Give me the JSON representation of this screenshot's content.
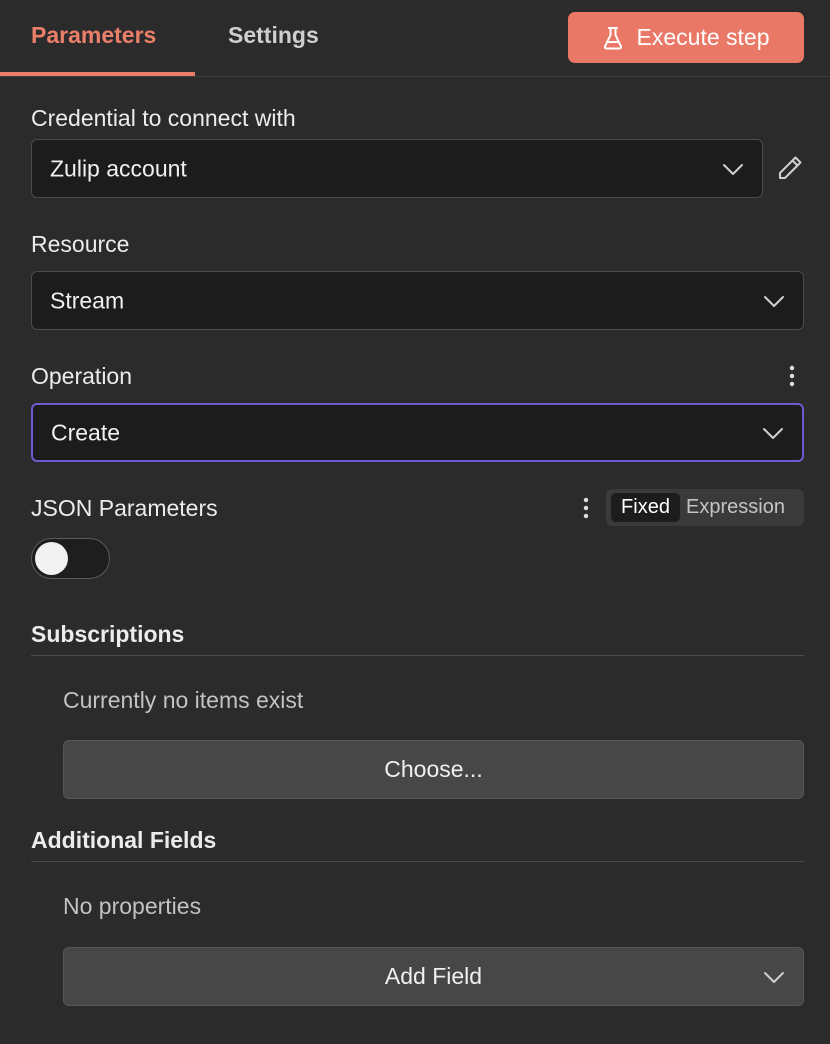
{
  "tabs": {
    "parameters": "Parameters",
    "settings": "Settings"
  },
  "execute_button": {
    "label": "Execute step",
    "icon": "flask-icon",
    "color": "#ea7866"
  },
  "credential": {
    "label": "Credential to connect with",
    "value": "Zulip account"
  },
  "resource": {
    "label": "Resource",
    "value": "Stream"
  },
  "operation": {
    "label": "Operation",
    "value": "Create",
    "focus_color": "#6b5bd0"
  },
  "json_parameters": {
    "label": "JSON Parameters",
    "toggle_on": false,
    "mode_fixed": "Fixed",
    "mode_expression": "Expression",
    "selected_mode": "Fixed"
  },
  "subscriptions": {
    "title": "Subscriptions",
    "empty_text": "Currently no items exist",
    "button_label": "Choose..."
  },
  "additional_fields": {
    "title": "Additional Fields",
    "empty_text": "No properties",
    "button_label": "Add Field"
  },
  "accent_color": "#ec7f6a"
}
